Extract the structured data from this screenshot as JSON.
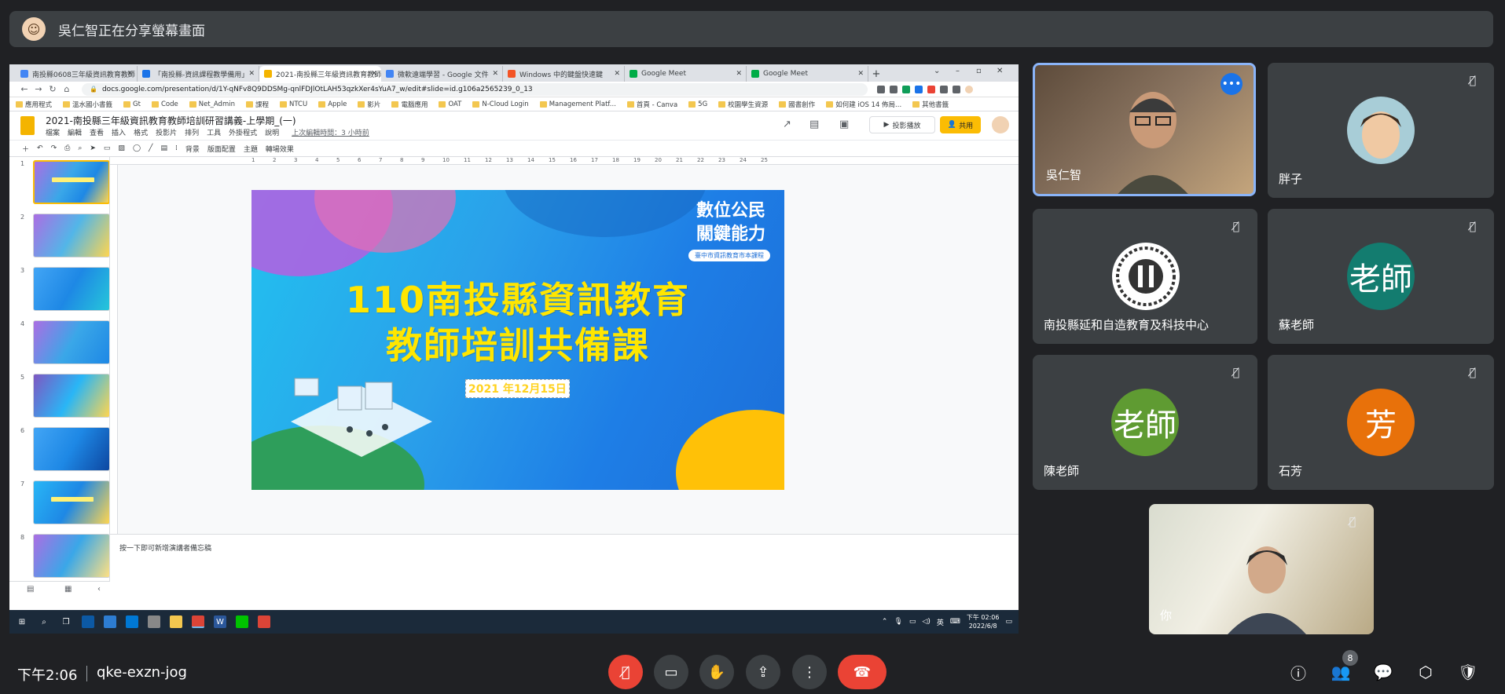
{
  "banner": {
    "text": "吳仁智正在分享螢幕畫面"
  },
  "browser": {
    "tabs": [
      {
        "label": "南投縣0608三年級資訊教育教師",
        "color": "#4285f4"
      },
      {
        "label": "「南投縣-資訊課程教學備用」",
        "color": "#1a73e8"
      },
      {
        "label": "2021-南投縣三年級資訊教育教師",
        "color": "#f4b400"
      },
      {
        "label": "微軟遠端學習 - Google 文件",
        "color": "#4285f4"
      },
      {
        "label": "Windows 中的鍵盤快速鍵",
        "color": "#f35325"
      },
      {
        "label": "Google Meet",
        "color": "#00ac47"
      },
      {
        "label": "Google Meet",
        "color": "#00ac47"
      }
    ],
    "url": "docs.google.com/presentation/d/1Y-qNFv8Q9DDSMg-qnlFDJlOtLAH53qzkXer4sYuA7_w/edit#slide=id.g106a2565239_0_13",
    "bookmarks": [
      "應用程式",
      "溫水國小書籤",
      "Gt",
      "Code",
      "Net_Admin",
      "課程",
      "NTCU",
      "Apple",
      "影片",
      "電腦應用",
      "OAT",
      "N-Cloud Login",
      "Management Platf...",
      "首頁 - Canva",
      "5G",
      "校園學生資源",
      "國書創作",
      "如何建 iOS 14 佈局..."
    ],
    "bookmarks_more": "其他書籤"
  },
  "slides_app": {
    "title": "2021-南投縣三年級資訊教育教師培訓研習講義-上學期_(一)",
    "menu": [
      "檔案",
      "編輯",
      "查看",
      "插入",
      "格式",
      "投影片",
      "排列",
      "工具",
      "外掛程式",
      "說明"
    ],
    "last_edit": "上次編輯時間：3 小時前",
    "present_label": "投影播放",
    "share_label": "共用",
    "toolbar": [
      "背景",
      "版面配置",
      "主題",
      "轉場效果"
    ],
    "thumb_numbers": [
      "1",
      "2",
      "3",
      "4",
      "5",
      "6",
      "7",
      "8"
    ],
    "notes_placeholder": "按一下即可新增演講者備忘稿",
    "ruler": [
      "1",
      "2",
      "3",
      "4",
      "5",
      "6",
      "7",
      "8",
      "9",
      "10",
      "11",
      "12",
      "13",
      "14",
      "15",
      "16",
      "17",
      "18",
      "19",
      "20",
      "21",
      "22",
      "23",
      "24",
      "25"
    ]
  },
  "slide": {
    "corner_line1": "數位公民",
    "corner_line2": "關鍵能力",
    "pill": "臺中市資訊教育市本課程",
    "title_line1": "110南投縣資訊教育",
    "title_line2": "教師培訓共備課",
    "date": "2021 年12月15日"
  },
  "taskbar": {
    "time": "下午 02:06",
    "date": "2022/6/8",
    "ime": "英"
  },
  "participants": [
    {
      "name": "吳仁智",
      "kind": "video"
    },
    {
      "name": "胖子",
      "kind": "avatar"
    },
    {
      "name": "南投縣延和自造教育及科技中心",
      "kind": "logo"
    },
    {
      "name": "蘇老師",
      "kind": "initial",
      "initial": "老師",
      "color": "#137c6f"
    },
    {
      "name": "陳老師",
      "kind": "initial",
      "initial": "老師",
      "color": "#5f9b32"
    },
    {
      "name": "石芳",
      "kind": "initial",
      "initial": "芳",
      "color": "#e8710a"
    },
    {
      "name": "你",
      "kind": "video"
    }
  ],
  "meeting": {
    "time": "下午2:06",
    "code": "qke-exzn-jog",
    "people_count": "8"
  }
}
